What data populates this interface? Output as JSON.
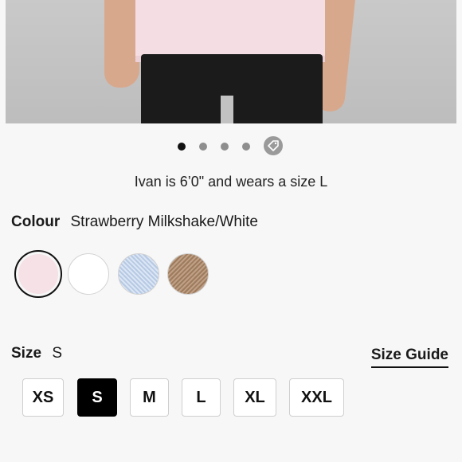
{
  "product_image": {
    "alt": "Model wearing shirt",
    "carousel": {
      "total_dots": 4,
      "active_index": 0,
      "extra_icon": "tag-icon"
    }
  },
  "fit_note": "Ivan is 6’0\" and wears a size L",
  "colour": {
    "label": "Colour",
    "selected_name": "Strawberry Milkshake/White",
    "swatches": [
      {
        "name": "Strawberry Milkshake/White",
        "color": "#f5e1e6",
        "selected": true
      },
      {
        "name": "White",
        "color": "#ffffff",
        "selected": false
      },
      {
        "name": "Light Blue Heather",
        "color": "#b9cce6",
        "selected": false
      },
      {
        "name": "Tan Heather",
        "color": "#a68465",
        "selected": false
      }
    ]
  },
  "size": {
    "label": "Size",
    "selected": "S",
    "guide_label": "Size Guide",
    "options": [
      "XS",
      "S",
      "M",
      "L",
      "XL",
      "XXL"
    ]
  },
  "colors": {
    "accent": "#000000",
    "background": "#f7f7f7"
  }
}
